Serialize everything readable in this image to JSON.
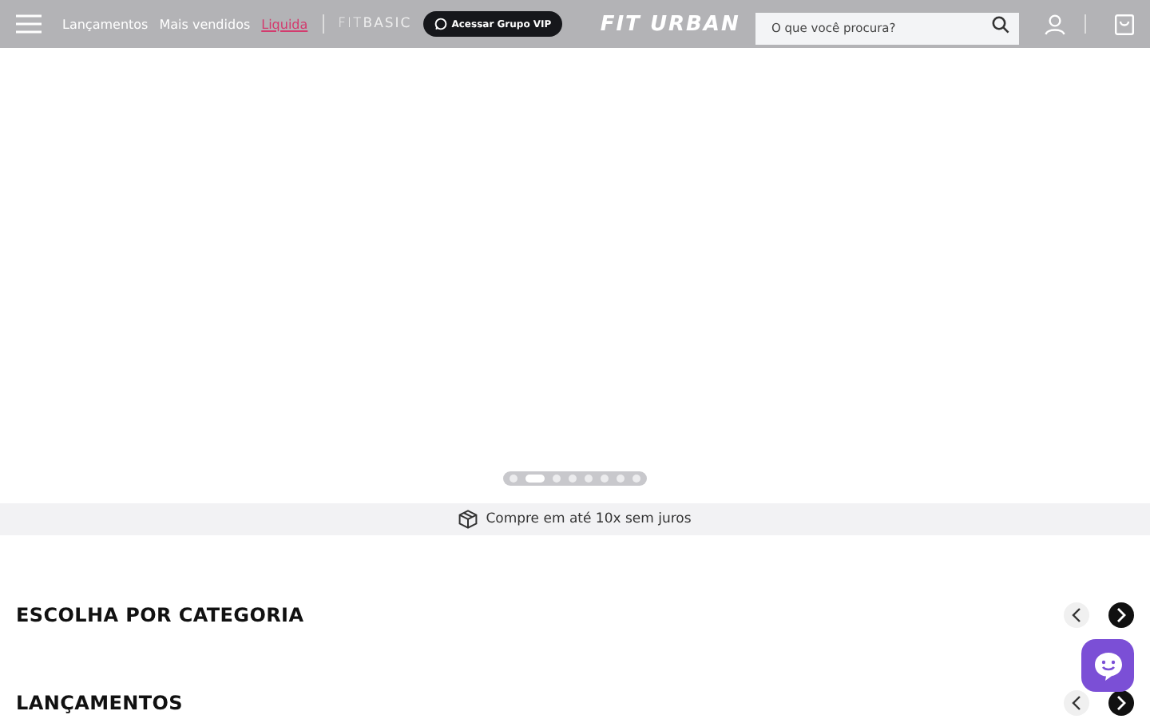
{
  "header": {
    "nav": [
      {
        "label": "Lançamentos",
        "kind": "plain"
      },
      {
        "label": "Mais vendidos",
        "kind": "plain"
      },
      {
        "label": "Liquida",
        "kind": "sale"
      }
    ],
    "sub_brand": "FIT**BASIC**",
    "vip_button": "Acessar Grupo VIP",
    "logo": "FIT URBAN",
    "search": {
      "placeholder": "O que você procura?"
    }
  },
  "carousel": {
    "dots": [
      {
        "selected": false
      },
      {
        "selected": true
      },
      {
        "selected": false
      },
      {
        "selected": false
      },
      {
        "selected": false
      },
      {
        "selected": false
      },
      {
        "selected": false
      },
      {
        "selected": false
      }
    ]
  },
  "info_bar": "Compre em até 10x sem juros",
  "sections": [
    {
      "title": "ESCOLHA POR CATEGORIA"
    },
    {
      "title": "LANÇAMENTOS"
    }
  ]
}
